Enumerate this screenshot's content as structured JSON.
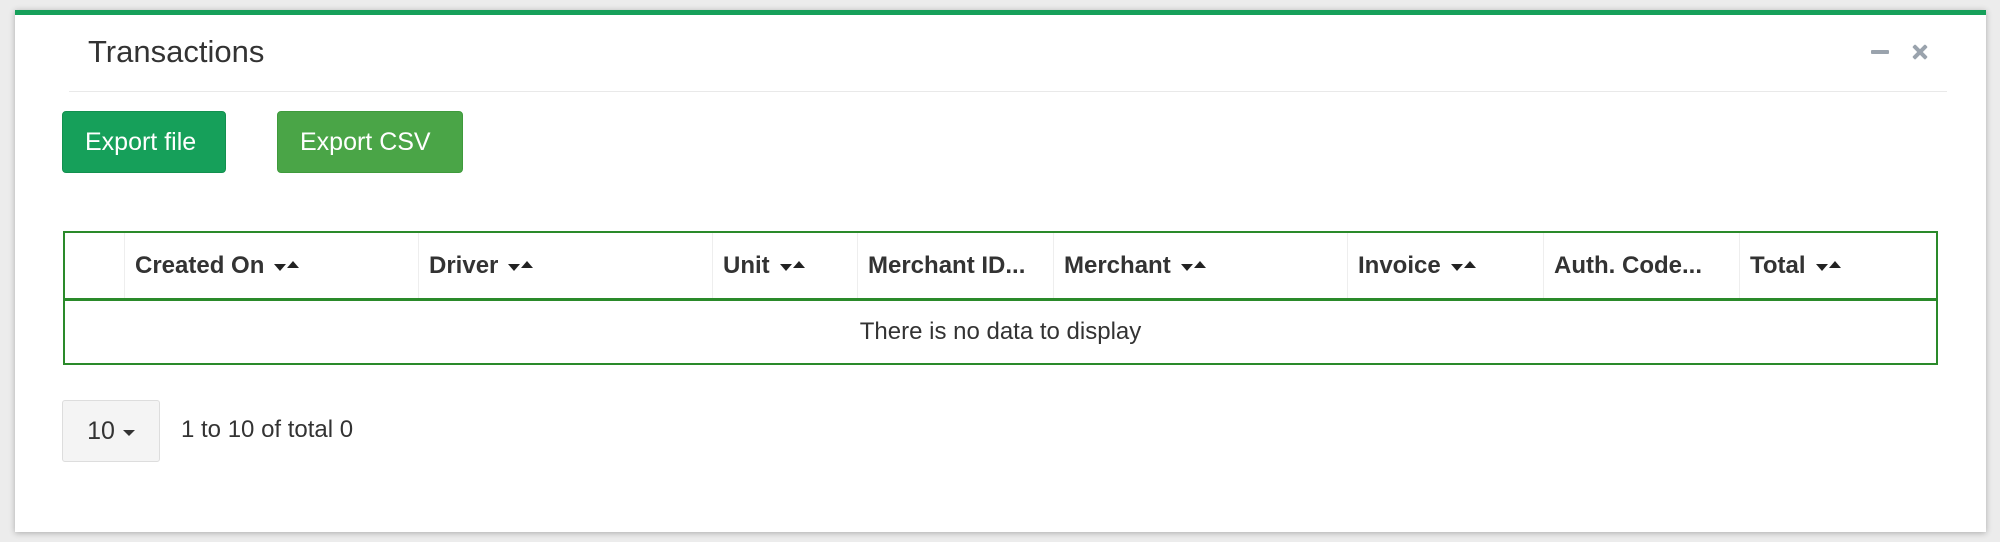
{
  "panel": {
    "title": "Transactions",
    "accent_color": "#16a05a",
    "tools": [
      {
        "icon": "minus-icon"
      },
      {
        "icon": "close-icon"
      }
    ]
  },
  "toolbar": {
    "export_file_label": "Export file",
    "export_file_color": "#16a05a",
    "export_csv_label": "Export CSV",
    "export_csv_color": "#4aa547"
  },
  "table": {
    "columns": [
      {
        "label": "",
        "sortable": false
      },
      {
        "label": "Created On",
        "sortable": true
      },
      {
        "label": "Driver",
        "sortable": true
      },
      {
        "label": "Unit",
        "sortable": true
      },
      {
        "label": "Merchant ID...",
        "sortable": false
      },
      {
        "label": "Merchant",
        "sortable": true
      },
      {
        "label": "Invoice",
        "sortable": true
      },
      {
        "label": "Auth. Code...",
        "sortable": false
      },
      {
        "label": "Total",
        "sortable": true
      }
    ],
    "empty_message": "There is no data to display",
    "border_color": "#2a8a2a"
  },
  "pager": {
    "page_size": "10",
    "info": "1 to 10 of total 0"
  }
}
